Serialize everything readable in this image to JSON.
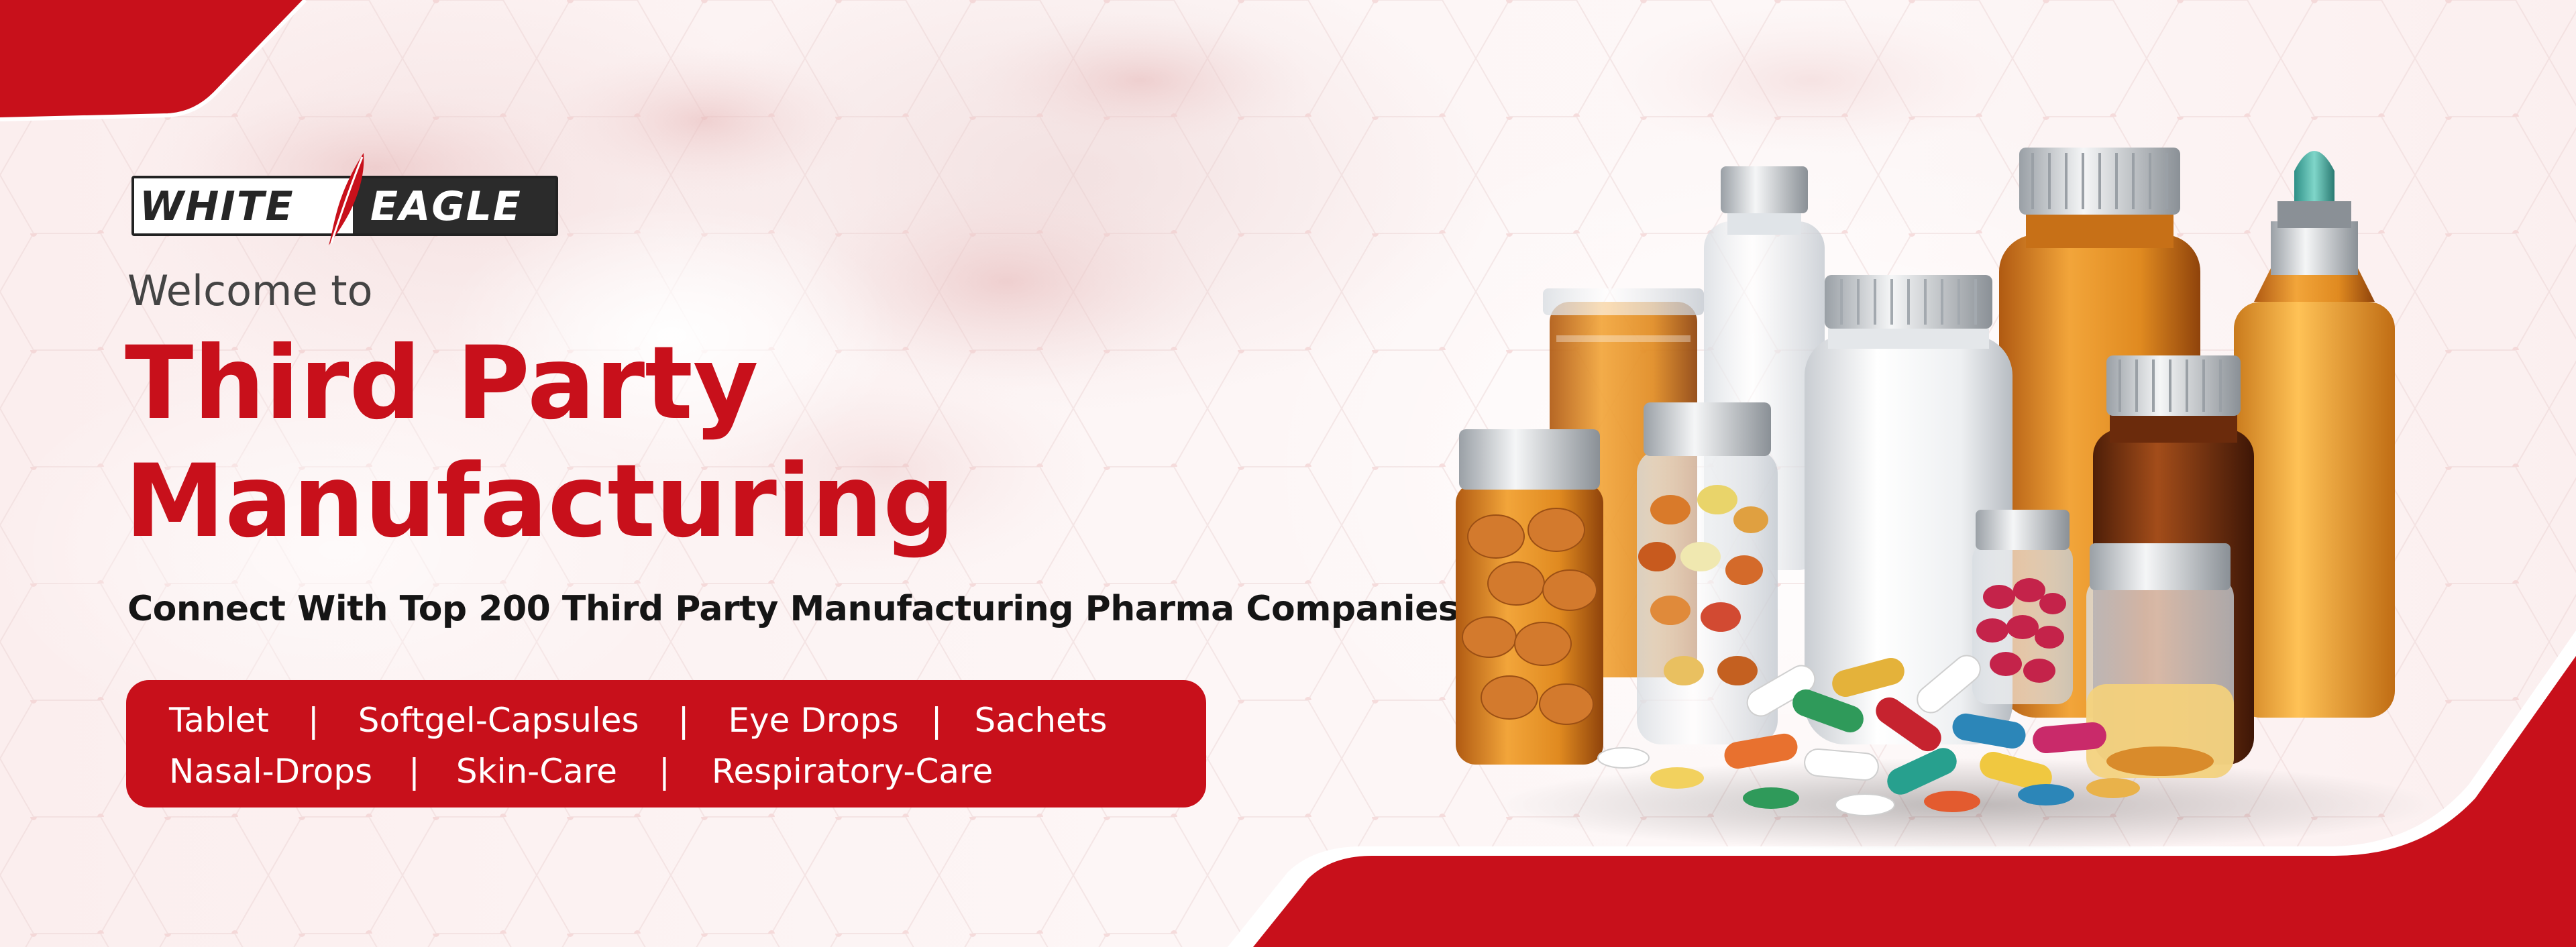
{
  "brand": {
    "logo_text_left": "WHITE",
    "logo_text_right": "EAGLE"
  },
  "hero": {
    "welcome": "Welcome to",
    "headline_line1": "Third Party",
    "headline_line2": "Manufacturing",
    "subheadline": "Connect With Top 200 Third Party Manufacturing Pharma Companies"
  },
  "categories": {
    "row1": [
      "Tablet",
      "Softgel-Capsules",
      "Eye Drops",
      "Sachets"
    ],
    "row2": [
      "Nasal-Drops",
      "Skin-Care",
      "Respiratory-Care"
    ],
    "separator": "|"
  },
  "colors": {
    "brand_red": "#c8101b",
    "text_dark": "#151515",
    "text_gray": "#444444",
    "background": "#fbf1f1"
  },
  "icons": {
    "logo_mark": "red-feather-icon",
    "illustration": "medicine-bottles-and-pills"
  }
}
